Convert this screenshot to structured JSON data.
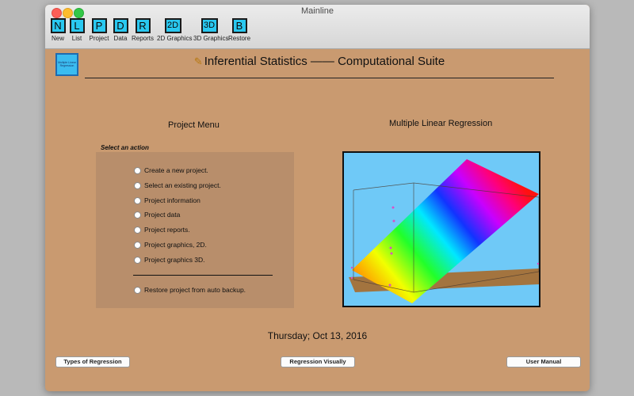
{
  "window": {
    "title": "Mainline"
  },
  "toolbar": [
    {
      "key": "new",
      "glyph": "N",
      "label": "New"
    },
    {
      "key": "list",
      "glyph": "L",
      "label": "List"
    },
    {
      "key": "project",
      "glyph": "P",
      "label": "Project"
    },
    {
      "key": "data",
      "glyph": "D",
      "label": "Data"
    },
    {
      "key": "reports",
      "glyph": "R",
      "label": "Reports"
    },
    {
      "key": "graphics-2d",
      "glyph": "2D",
      "label": "2D Graphics"
    },
    {
      "key": "graphics-3d",
      "glyph": "3D",
      "label": "3D Graphics"
    },
    {
      "key": "restore",
      "glyph": "B",
      "label": "Restore"
    }
  ],
  "header": {
    "logo_text": "Multiple Linear Regression",
    "title": "Inferential Statistics —— Computational Suite",
    "title_icon": "pencil-icon"
  },
  "project_menu": {
    "heading": "Project Menu",
    "hint": "Select an action",
    "options": [
      "Create a new project.",
      "Select an existing project.",
      "Project information",
      "Project data",
      "Project reports.",
      "Project graphics, 2D.",
      "Project graphics 3D."
    ],
    "restore_option": "Restore project from auto backup."
  },
  "preview": {
    "heading": "Multiple Linear Regression"
  },
  "date": "Thursday; Oct 13, 2016",
  "buttons": {
    "types": "Types of Regression",
    "visual": "Regression Visually",
    "manual": "User Manual"
  },
  "colors": {
    "background": "#c99a70",
    "panel": "#b88e6b",
    "toolbar_icon": "#29c8f0",
    "plot_background": "#6fc9f7"
  }
}
